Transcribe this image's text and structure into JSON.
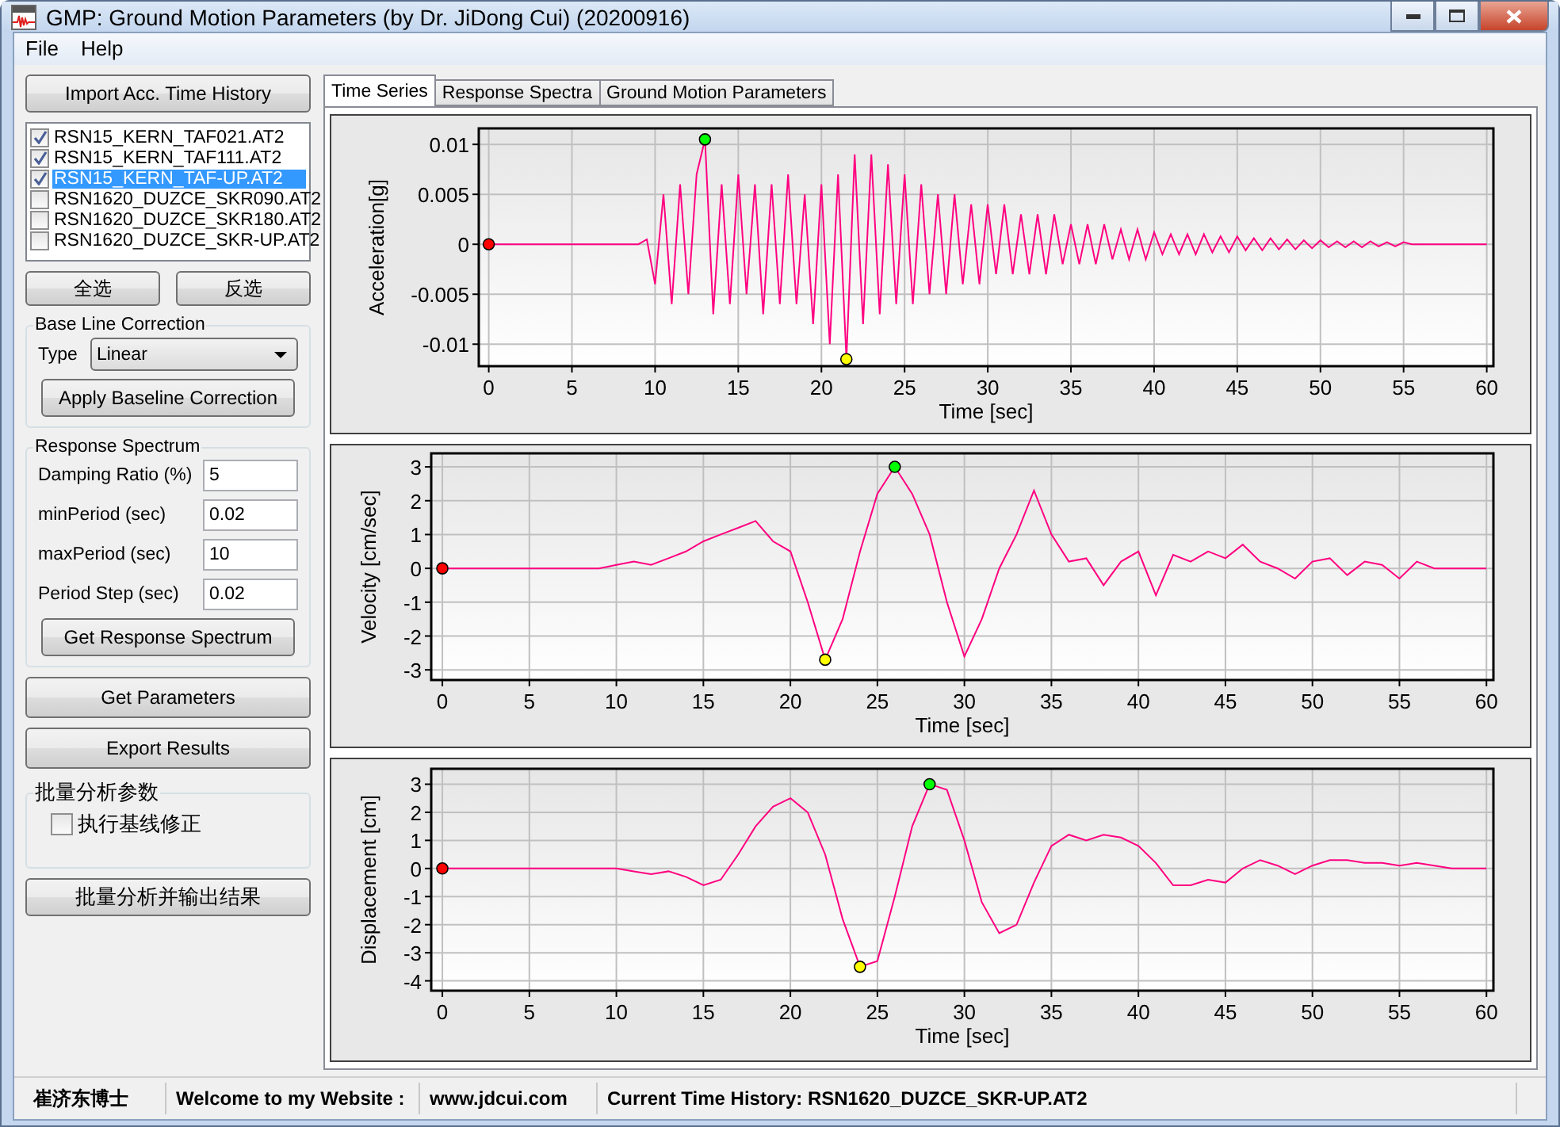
{
  "window": {
    "title": "GMP: Ground Motion Parameters (by Dr. JiDong Cui) (20200916)"
  },
  "menu": [
    "File",
    "Help"
  ],
  "sidebar": {
    "import_button": "Import Acc. Time History",
    "files": [
      {
        "name": "RSN15_KERN_TAF021.AT2",
        "checked": true,
        "selected": false
      },
      {
        "name": "RSN15_KERN_TAF111.AT2",
        "checked": true,
        "selected": false
      },
      {
        "name": "RSN15_KERN_TAF-UP.AT2",
        "checked": true,
        "selected": true
      },
      {
        "name": "RSN1620_DUZCE_SKR090.AT2",
        "checked": false,
        "selected": false
      },
      {
        "name": "RSN1620_DUZCE_SKR180.AT2",
        "checked": false,
        "selected": false
      },
      {
        "name": "RSN1620_DUZCE_SKR-UP.AT2",
        "checked": false,
        "selected": false
      }
    ],
    "select_buttons": [
      "全选",
      "反选"
    ],
    "baseline": {
      "title": "Base Line Correction",
      "type_label": "Type",
      "type_value": "Linear",
      "button": "Apply Baseline Correction"
    },
    "response": {
      "title": "Response Spectrum",
      "fields": [
        {
          "label": "Damping Ratio (%)",
          "value": "5"
        },
        {
          "label": "minPeriod (sec)",
          "value": "0.02"
        },
        {
          "label": "maxPeriod (sec)",
          "value": "10"
        },
        {
          "label": "Period Step (sec)",
          "value": "0.02"
        }
      ],
      "button": "Get Response Spectrum"
    },
    "actions": [
      "Get Parameters",
      "Export Results"
    ],
    "batch": {
      "title": "批量分析参数",
      "option": {
        "label": "执行基线修正",
        "checked": false
      }
    },
    "batch_button": "批量分析并输出结果"
  },
  "tabs": [
    {
      "label": "Time Series",
      "selected": true
    },
    {
      "label": "Response Spectra",
      "selected": false
    },
    {
      "label": "Ground Motion Parameters",
      "selected": false
    }
  ],
  "charts": [
    {
      "chart_data": {
        "type": "line",
        "xlabel": "Time [sec]",
        "ylabel": "Acceleration[g]",
        "x": [
          0,
          0.5,
          1,
          1.5,
          2,
          2.5,
          3,
          3.5,
          4,
          4.5,
          5,
          5.5,
          6,
          6.5,
          7,
          7.5,
          8,
          8.5,
          9,
          9.5,
          10,
          10.5,
          11,
          11.5,
          12,
          12.5,
          13,
          13.5,
          14,
          14.5,
          15,
          15.5,
          16,
          16.5,
          17,
          17.5,
          18,
          18.5,
          19,
          19.5,
          20,
          20.5,
          21,
          21.5,
          22,
          22.5,
          23,
          23.5,
          24,
          24.5,
          25,
          25.5,
          26,
          26.5,
          27,
          27.5,
          28,
          28.5,
          29,
          29.5,
          30,
          30.5,
          31,
          31.5,
          32,
          32.5,
          33,
          33.5,
          34,
          34.5,
          35,
          35.5,
          36,
          36.5,
          37,
          37.5,
          38,
          38.5,
          39,
          39.5,
          40,
          40.5,
          41,
          41.5,
          42,
          42.5,
          43,
          43.5,
          44,
          44.5,
          45,
          45.5,
          46,
          46.5,
          47,
          47.5,
          48,
          48.5,
          49,
          49.5,
          50,
          50.5,
          51,
          51.5,
          52,
          52.5,
          53,
          53.5,
          54,
          54.5,
          55,
          55.5,
          56,
          56.5,
          57,
          57.5,
          58,
          58.5,
          59,
          59.5,
          60
        ],
        "series": [
          {
            "color": "#ff0080",
            "values": [
              0,
              0,
              0,
              0,
              0,
              0,
              0,
              0,
              0,
              0,
              0,
              0,
              0,
              0,
              0,
              0,
              0,
              0,
              0,
              0.0005,
              -0.004,
              0.005,
              -0.006,
              0.006,
              -0.005,
              0.007,
              0.0105,
              -0.007,
              0.006,
              -0.006,
              0.007,
              -0.005,
              0.006,
              -0.007,
              0.006,
              -0.006,
              0.007,
              -0.006,
              0.005,
              -0.008,
              0.006,
              -0.01,
              0.007,
              -0.0115,
              0.009,
              -0.008,
              0.009,
              -0.007,
              0.008,
              -0.006,
              0.007,
              -0.006,
              0.006,
              -0.005,
              0.005,
              -0.005,
              0.005,
              -0.004,
              0.004,
              -0.004,
              0.004,
              -0.003,
              0.004,
              -0.003,
              0.003,
              -0.003,
              0.003,
              -0.003,
              0.003,
              -0.002,
              0.002,
              -0.002,
              0.002,
              -0.002,
              0.002,
              -0.0015,
              0.0015,
              -0.0015,
              0.0015,
              -0.0015,
              0.0012,
              -0.001,
              0.001,
              -0.001,
              0.001,
              -0.001,
              0.001,
              -0.0008,
              0.0008,
              -0.0008,
              0.0008,
              -0.0006,
              0.0006,
              -0.0006,
              0.0006,
              -0.0005,
              0.0005,
              -0.0005,
              0.0004,
              -0.0004,
              0.0004,
              -0.0003,
              0.0003,
              -0.0003,
              0.0003,
              -0.0003,
              0.0003,
              -0.0002,
              0.0002,
              -0.0002,
              0.0002,
              0,
              0,
              0,
              0,
              0,
              0,
              0,
              0,
              0,
              0
            ]
          }
        ],
        "xlim": [
          -0.6,
          60.4
        ],
        "ylim": [
          -0.0122,
          0.0116
        ],
        "xticks": [
          0,
          5,
          10,
          15,
          20,
          25,
          30,
          35,
          40,
          45,
          50,
          55,
          60
        ],
        "yticks": [
          -0.01,
          -0.005,
          0,
          0.005,
          0.01
        ],
        "grid": true
      }
    },
    {
      "chart_data": {
        "type": "line",
        "xlabel": "Time [sec]",
        "ylabel": "Velocity [cm/sec]",
        "x": [
          0,
          1,
          2,
          3,
          4,
          5,
          6,
          7,
          8,
          9,
          10,
          11,
          12,
          13,
          14,
          15,
          16,
          17,
          18,
          19,
          20,
          21,
          22,
          23,
          24,
          25,
          26,
          27,
          28,
          29,
          30,
          31,
          32,
          33,
          34,
          35,
          36,
          37,
          38,
          39,
          40,
          41,
          42,
          43,
          44,
          45,
          46,
          47,
          48,
          49,
          50,
          51,
          52,
          53,
          54,
          55,
          56,
          57,
          58,
          59,
          60
        ],
        "series": [
          {
            "color": "#ff0080",
            "values": [
              0,
              0,
              0,
              0,
              0,
              0,
              0,
              0,
              0,
              0,
              0.1,
              0.2,
              0.1,
              0.3,
              0.5,
              0.8,
              1.0,
              1.2,
              1.4,
              0.8,
              0.5,
              -1.0,
              -2.7,
              -1.5,
              0.5,
              2.2,
              3.0,
              2.2,
              1.0,
              -1.0,
              -2.6,
              -1.5,
              0,
              1.0,
              2.3,
              1.0,
              0.2,
              0.3,
              -0.5,
              0.2,
              0.5,
              -0.8,
              0.4,
              0.2,
              0.5,
              0.3,
              0.7,
              0.2,
              0,
              -0.3,
              0.2,
              0.3,
              -0.2,
              0.2,
              0.1,
              -0.3,
              0.2,
              0,
              0,
              0,
              0
            ]
          }
        ],
        "xlim": [
          -0.64,
          60.4
        ],
        "ylim": [
          -3.3,
          3.4
        ],
        "xticks": [
          0,
          5,
          10,
          15,
          20,
          25,
          30,
          35,
          40,
          45,
          50,
          55,
          60
        ],
        "yticks": [
          -3,
          -2,
          -1,
          0,
          1,
          2,
          3
        ],
        "grid": true
      }
    },
    {
      "chart_data": {
        "type": "line",
        "xlabel": "Time [sec]",
        "ylabel": "Displacement [cm]",
        "x": [
          0,
          1,
          2,
          3,
          4,
          5,
          6,
          7,
          8,
          9,
          10,
          11,
          12,
          13,
          14,
          15,
          16,
          17,
          18,
          19,
          20,
          21,
          22,
          23,
          24,
          25,
          26,
          27,
          28,
          29,
          30,
          31,
          32,
          33,
          34,
          35,
          36,
          37,
          38,
          39,
          40,
          41,
          42,
          43,
          44,
          45,
          46,
          47,
          48,
          49,
          50,
          51,
          52,
          53,
          54,
          55,
          56,
          57,
          58,
          59,
          60
        ],
        "series": [
          {
            "color": "#ff0080",
            "values": [
              0,
              0,
              0,
              0,
              0,
              0,
              0,
              0,
              0,
              0,
              0,
              -0.1,
              -0.2,
              -0.1,
              -0.3,
              -0.6,
              -0.4,
              0.5,
              1.5,
              2.2,
              2.5,
              2.0,
              0.5,
              -1.8,
              -3.5,
              -3.3,
              -1.0,
              1.5,
              3.0,
              2.8,
              1.0,
              -1.2,
              -2.3,
              -2.0,
              -0.5,
              0.8,
              1.2,
              1.0,
              1.2,
              1.1,
              0.8,
              0.2,
              -0.6,
              -0.6,
              -0.4,
              -0.5,
              0,
              0.3,
              0.1,
              -0.2,
              0.1,
              0.3,
              0.3,
              0.2,
              0.2,
              0.1,
              0.2,
              0.1,
              0,
              0,
              0
            ]
          }
        ],
        "xlim": [
          -0.64,
          60.4
        ],
        "ylim": [
          -4.35,
          3.55
        ],
        "xticks": [
          0,
          5,
          10,
          15,
          20,
          25,
          30,
          35,
          40,
          45,
          50,
          55,
          60
        ],
        "yticks": [
          -4,
          -3,
          -2,
          -1,
          0,
          1,
          2,
          3
        ],
        "grid": true
      }
    }
  ],
  "status_bar": [
    "崔济东博士",
    "Welcome to my Website :",
    "www.jdcui.com",
    "Current Time History: RSN1620_DUZCE_SKR-UP.AT2"
  ]
}
